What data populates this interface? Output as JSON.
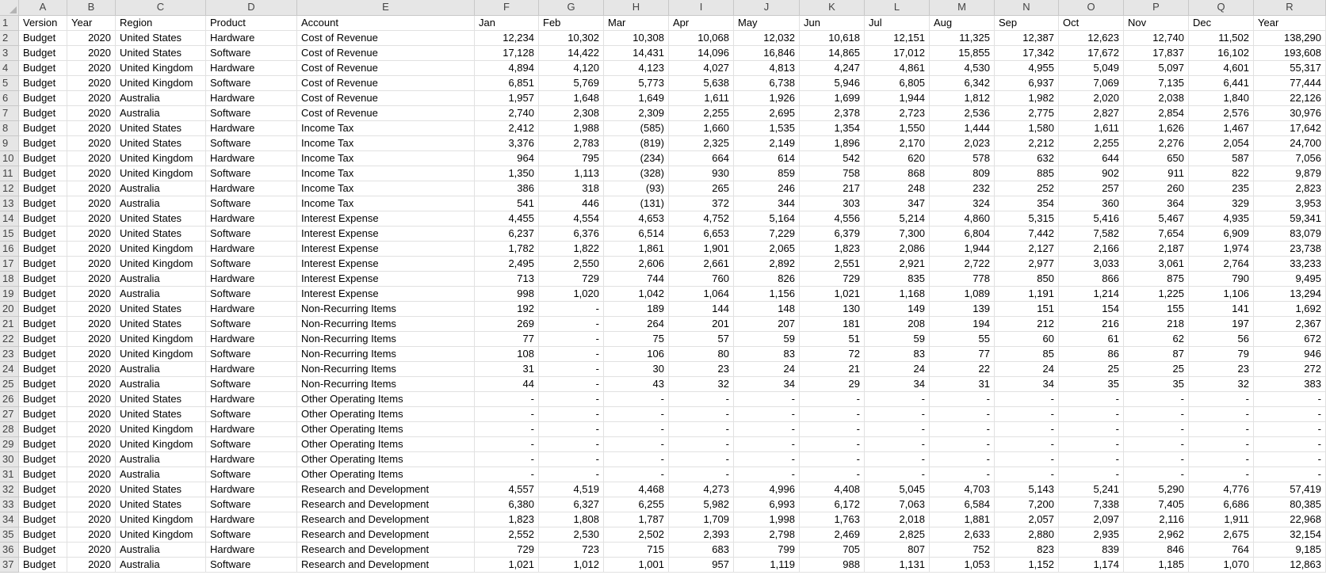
{
  "sheet": {
    "column_letters": [
      "A",
      "B",
      "C",
      "D",
      "E",
      "F",
      "G",
      "H",
      "I",
      "J",
      "K",
      "L",
      "M",
      "N",
      "O",
      "P",
      "Q",
      "R"
    ],
    "header": [
      "Version",
      "Year",
      "Region",
      "Product",
      "Account",
      "Jan",
      "Feb",
      "Mar",
      "Apr",
      "May",
      "Jun",
      "Jul",
      "Aug",
      "Sep",
      "Oct",
      "Nov",
      "Dec",
      "Year"
    ],
    "rows": [
      [
        "2",
        [
          "Budget",
          "2020",
          "United States",
          "Hardware",
          "Cost of Revenue",
          "12,234",
          "10,302",
          "10,308",
          "10,068",
          "12,032",
          "10,618",
          "12,151",
          "11,325",
          "12,387",
          "12,623",
          "12,740",
          "11,502",
          "138,290"
        ]
      ],
      [
        "3",
        [
          "Budget",
          "2020",
          "United States",
          "Software",
          "Cost of Revenue",
          "17,128",
          "14,422",
          "14,431",
          "14,096",
          "16,846",
          "14,865",
          "17,012",
          "15,855",
          "17,342",
          "17,672",
          "17,837",
          "16,102",
          "193,608"
        ]
      ],
      [
        "4",
        [
          "Budget",
          "2020",
          "United Kingdom",
          "Hardware",
          "Cost of Revenue",
          "4,894",
          "4,120",
          "4,123",
          "4,027",
          "4,813",
          "4,247",
          "4,861",
          "4,530",
          "4,955",
          "5,049",
          "5,097",
          "4,601",
          "55,317"
        ]
      ],
      [
        "5",
        [
          "Budget",
          "2020",
          "United Kingdom",
          "Software",
          "Cost of Revenue",
          "6,851",
          "5,769",
          "5,773",
          "5,638",
          "6,738",
          "5,946",
          "6,805",
          "6,342",
          "6,937",
          "7,069",
          "7,135",
          "6,441",
          "77,444"
        ]
      ],
      [
        "6",
        [
          "Budget",
          "2020",
          "Australia",
          "Hardware",
          "Cost of Revenue",
          "1,957",
          "1,648",
          "1,649",
          "1,611",
          "1,926",
          "1,699",
          "1,944",
          "1,812",
          "1,982",
          "2,020",
          "2,038",
          "1,840",
          "22,126"
        ]
      ],
      [
        "7",
        [
          "Budget",
          "2020",
          "Australia",
          "Software",
          "Cost of Revenue",
          "2,740",
          "2,308",
          "2,309",
          "2,255",
          "2,695",
          "2,378",
          "2,723",
          "2,536",
          "2,775",
          "2,827",
          "2,854",
          "2,576",
          "30,976"
        ]
      ],
      [
        "8",
        [
          "Budget",
          "2020",
          "United States",
          "Hardware",
          "Income Tax",
          "2,412",
          "1,988",
          "(585)",
          "1,660",
          "1,535",
          "1,354",
          "1,550",
          "1,444",
          "1,580",
          "1,611",
          "1,626",
          "1,467",
          "17,642"
        ]
      ],
      [
        "9",
        [
          "Budget",
          "2020",
          "United States",
          "Software",
          "Income Tax",
          "3,376",
          "2,783",
          "(819)",
          "2,325",
          "2,149",
          "1,896",
          "2,170",
          "2,023",
          "2,212",
          "2,255",
          "2,276",
          "2,054",
          "24,700"
        ]
      ],
      [
        "10",
        [
          "Budget",
          "2020",
          "United Kingdom",
          "Hardware",
          "Income Tax",
          "964",
          "795",
          "(234)",
          "664",
          "614",
          "542",
          "620",
          "578",
          "632",
          "644",
          "650",
          "587",
          "7,056"
        ]
      ],
      [
        "11",
        [
          "Budget",
          "2020",
          "United Kingdom",
          "Software",
          "Income Tax",
          "1,350",
          "1,113",
          "(328)",
          "930",
          "859",
          "758",
          "868",
          "809",
          "885",
          "902",
          "911",
          "822",
          "9,879"
        ]
      ],
      [
        "12",
        [
          "Budget",
          "2020",
          "Australia",
          "Hardware",
          "Income Tax",
          "386",
          "318",
          "(93)",
          "265",
          "246",
          "217",
          "248",
          "232",
          "252",
          "257",
          "260",
          "235",
          "2,823"
        ]
      ],
      [
        "13",
        [
          "Budget",
          "2020",
          "Australia",
          "Software",
          "Income Tax",
          "541",
          "446",
          "(131)",
          "372",
          "344",
          "303",
          "347",
          "324",
          "354",
          "360",
          "364",
          "329",
          "3,953"
        ]
      ],
      [
        "14",
        [
          "Budget",
          "2020",
          "United States",
          "Hardware",
          "Interest Expense",
          "4,455",
          "4,554",
          "4,653",
          "4,752",
          "5,164",
          "4,556",
          "5,214",
          "4,860",
          "5,315",
          "5,416",
          "5,467",
          "4,935",
          "59,341"
        ]
      ],
      [
        "15",
        [
          "Budget",
          "2020",
          "United States",
          "Software",
          "Interest Expense",
          "6,237",
          "6,376",
          "6,514",
          "6,653",
          "7,229",
          "6,379",
          "7,300",
          "6,804",
          "7,442",
          "7,582",
          "7,654",
          "6,909",
          "83,079"
        ]
      ],
      [
        "16",
        [
          "Budget",
          "2020",
          "United Kingdom",
          "Hardware",
          "Interest Expense",
          "1,782",
          "1,822",
          "1,861",
          "1,901",
          "2,065",
          "1,823",
          "2,086",
          "1,944",
          "2,127",
          "2,166",
          "2,187",
          "1,974",
          "23,738"
        ]
      ],
      [
        "17",
        [
          "Budget",
          "2020",
          "United Kingdom",
          "Software",
          "Interest Expense",
          "2,495",
          "2,550",
          "2,606",
          "2,661",
          "2,892",
          "2,551",
          "2,921",
          "2,722",
          "2,977",
          "3,033",
          "3,061",
          "2,764",
          "33,233"
        ]
      ],
      [
        "18",
        [
          "Budget",
          "2020",
          "Australia",
          "Hardware",
          "Interest Expense",
          "713",
          "729",
          "744",
          "760",
          "826",
          "729",
          "835",
          "778",
          "850",
          "866",
          "875",
          "790",
          "9,495"
        ]
      ],
      [
        "19",
        [
          "Budget",
          "2020",
          "Australia",
          "Software",
          "Interest Expense",
          "998",
          "1,020",
          "1,042",
          "1,064",
          "1,156",
          "1,021",
          "1,168",
          "1,089",
          "1,191",
          "1,214",
          "1,225",
          "1,106",
          "13,294"
        ]
      ],
      [
        "20",
        [
          "Budget",
          "2020",
          "United States",
          "Hardware",
          "Non-Recurring Items",
          "192",
          "-",
          "189",
          "144",
          "148",
          "130",
          "149",
          "139",
          "151",
          "154",
          "155",
          "141",
          "1,692"
        ]
      ],
      [
        "21",
        [
          "Budget",
          "2020",
          "United States",
          "Software",
          "Non-Recurring Items",
          "269",
          "-",
          "264",
          "201",
          "207",
          "181",
          "208",
          "194",
          "212",
          "216",
          "218",
          "197",
          "2,367"
        ]
      ],
      [
        "22",
        [
          "Budget",
          "2020",
          "United Kingdom",
          "Hardware",
          "Non-Recurring Items",
          "77",
          "-",
          "75",
          "57",
          "59",
          "51",
          "59",
          "55",
          "60",
          "61",
          "62",
          "56",
          "672"
        ]
      ],
      [
        "23",
        [
          "Budget",
          "2020",
          "United Kingdom",
          "Software",
          "Non-Recurring Items",
          "108",
          "-",
          "106",
          "80",
          "83",
          "72",
          "83",
          "77",
          "85",
          "86",
          "87",
          "79",
          "946"
        ]
      ],
      [
        "24",
        [
          "Budget",
          "2020",
          "Australia",
          "Hardware",
          "Non-Recurring Items",
          "31",
          "-",
          "30",
          "23",
          "24",
          "21",
          "24",
          "22",
          "24",
          "25",
          "25",
          "23",
          "272"
        ]
      ],
      [
        "25",
        [
          "Budget",
          "2020",
          "Australia",
          "Software",
          "Non-Recurring Items",
          "44",
          "-",
          "43",
          "32",
          "34",
          "29",
          "34",
          "31",
          "34",
          "35",
          "35",
          "32",
          "383"
        ]
      ],
      [
        "26",
        [
          "Budget",
          "2020",
          "United States",
          "Hardware",
          "Other Operating Items",
          "-",
          "-",
          "-",
          "-",
          "-",
          "-",
          "-",
          "-",
          "-",
          "-",
          "-",
          "-",
          "-"
        ]
      ],
      [
        "27",
        [
          "Budget",
          "2020",
          "United States",
          "Software",
          "Other Operating Items",
          "-",
          "-",
          "-",
          "-",
          "-",
          "-",
          "-",
          "-",
          "-",
          "-",
          "-",
          "-",
          "-"
        ]
      ],
      [
        "28",
        [
          "Budget",
          "2020",
          "United Kingdom",
          "Hardware",
          "Other Operating Items",
          "-",
          "-",
          "-",
          "-",
          "-",
          "-",
          "-",
          "-",
          "-",
          "-",
          "-",
          "-",
          "-"
        ]
      ],
      [
        "29",
        [
          "Budget",
          "2020",
          "United Kingdom",
          "Software",
          "Other Operating Items",
          "-",
          "-",
          "-",
          "-",
          "-",
          "-",
          "-",
          "-",
          "-",
          "-",
          "-",
          "-",
          "-"
        ]
      ],
      [
        "30",
        [
          "Budget",
          "2020",
          "Australia",
          "Hardware",
          "Other Operating Items",
          "-",
          "-",
          "-",
          "-",
          "-",
          "-",
          "-",
          "-",
          "-",
          "-",
          "-",
          "-",
          "-"
        ]
      ],
      [
        "31",
        [
          "Budget",
          "2020",
          "Australia",
          "Software",
          "Other Operating Items",
          "-",
          "-",
          "-",
          "-",
          "-",
          "-",
          "-",
          "-",
          "-",
          "-",
          "-",
          "-",
          "-"
        ]
      ],
      [
        "32",
        [
          "Budget",
          "2020",
          "United States",
          "Hardware",
          "Research and Development",
          "4,557",
          "4,519",
          "4,468",
          "4,273",
          "4,996",
          "4,408",
          "5,045",
          "4,703",
          "5,143",
          "5,241",
          "5,290",
          "4,776",
          "57,419"
        ]
      ],
      [
        "33",
        [
          "Budget",
          "2020",
          "United States",
          "Software",
          "Research and Development",
          "6,380",
          "6,327",
          "6,255",
          "5,982",
          "6,993",
          "6,172",
          "7,063",
          "6,584",
          "7,200",
          "7,338",
          "7,405",
          "6,686",
          "80,385"
        ]
      ],
      [
        "34",
        [
          "Budget",
          "2020",
          "United Kingdom",
          "Hardware",
          "Research and Development",
          "1,823",
          "1,808",
          "1,787",
          "1,709",
          "1,998",
          "1,763",
          "2,018",
          "1,881",
          "2,057",
          "2,097",
          "2,116",
          "1,911",
          "22,968"
        ]
      ],
      [
        "35",
        [
          "Budget",
          "2020",
          "United Kingdom",
          "Software",
          "Research and Development",
          "2,552",
          "2,530",
          "2,502",
          "2,393",
          "2,798",
          "2,469",
          "2,825",
          "2,633",
          "2,880",
          "2,935",
          "2,962",
          "2,675",
          "32,154"
        ]
      ],
      [
        "36",
        [
          "Budget",
          "2020",
          "Australia",
          "Hardware",
          "Research and Development",
          "729",
          "723",
          "715",
          "683",
          "799",
          "705",
          "807",
          "752",
          "823",
          "839",
          "846",
          "764",
          "9,185"
        ]
      ],
      [
        "37",
        [
          "Budget",
          "2020",
          "Australia",
          "Software",
          "Research and Development",
          "1,021",
          "1,012",
          "1,001",
          "957",
          "1,119",
          "988",
          "1,131",
          "1,053",
          "1,152",
          "1,174",
          "1,185",
          "1,070",
          "12,863"
        ]
      ]
    ]
  }
}
